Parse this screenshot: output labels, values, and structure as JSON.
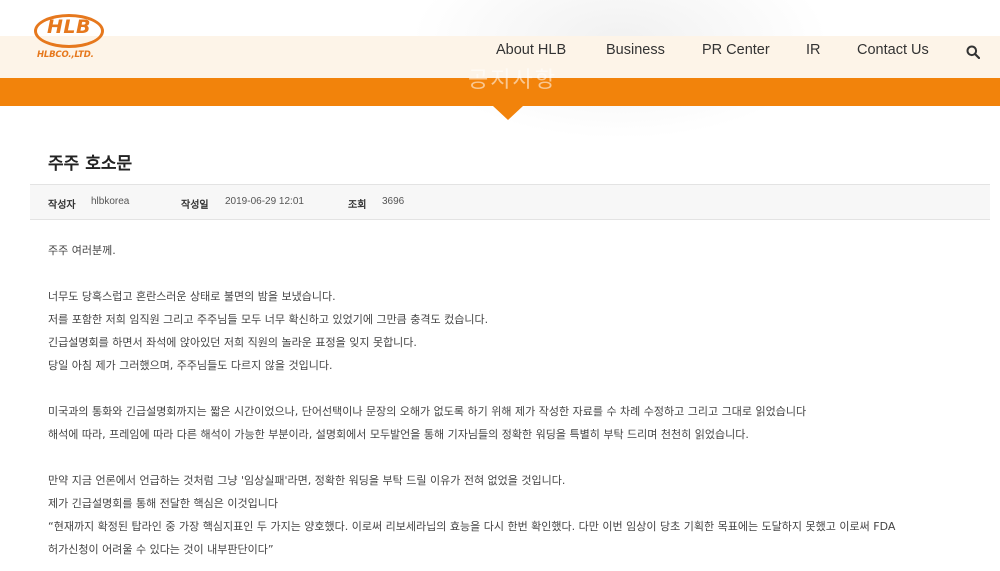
{
  "logo": {
    "main": "HLB",
    "sub": "HLBCO.,LTD."
  },
  "banner_title": "공지사항",
  "nav": {
    "items": [
      "About HLB",
      "Business",
      "PR Center",
      "IR",
      "Contact Us"
    ]
  },
  "icons": {
    "search": "search-icon"
  },
  "colors": {
    "accent": "#f2830b",
    "nav_band": "#fdf4e8",
    "meta_bg": "#f7f7f7"
  },
  "post": {
    "title": "주주 호소문",
    "meta": {
      "author_label": "작성자",
      "author": "hlbkorea",
      "date_label": "작성일",
      "date": "2019-06-29 12:01",
      "views_label": "조회",
      "views": "3696"
    },
    "body": [
      "주주 여러분께.",
      "너무도 당혹스럽고 혼란스러운 상태로 불면의 밤을 보냈습니다.",
      "저를 포함한 저희 임직원 그리고 주주님들 모두 너무 확신하고 있었기에 그만큼 충격도 컸습니다.",
      "긴급설명회를 하면서 좌석에 앉아있던 저희 직원의 놀라운 표정을 잊지 못합니다.",
      "당일 아침 제가 그러했으며, 주주님들도 다르지 않을 것입니다.",
      "미국과의 통화와 긴급설명회까지는 짧은 시간이었으나, 단어선택이나 문장의 오해가 없도록 하기 위해 제가 작성한 자료를 수 차례 수정하고 그리고 그대로 읽었습니다",
      "해석에 따라, 프레임에 따라 다른 해석이 가능한 부분이라, 설명회에서 모두발언을 통해 기자님들의 정확한 워딩을 특별히 부탁 드리며 천천히 읽었습니다.",
      "만약 지금 언론에서 언급하는 것처럼 그냥 '임상실패'라면, 정확한 워딩을 부탁 드릴 이유가 전혀 없었을 것입니다.",
      "제가 긴급설명회를 통해 전달한 핵심은 이것입니다",
      "“현재까지 확정된 탑라인 중 가장 핵심지표인 두 가지는 양호했다. 이로써 리보세라닙의 효능을 다시 한번 확인했다. 다만 이번 임상이 당초 기획한 목표에는 도달하지 못했고 이로써 FDA",
      "허가신청이 어려울 수 있다는 것이 내부판단이다”"
    ]
  }
}
